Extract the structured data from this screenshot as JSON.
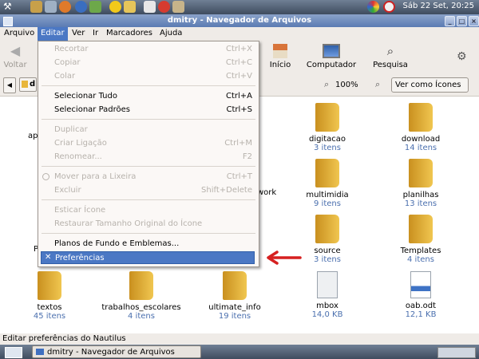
{
  "window": {
    "title": "dmitry - Navegador de Arquivos"
  },
  "top_panel": {
    "clock": "Sáb 22 Set, 20:25"
  },
  "menubar": [
    "Arquivo",
    "Editar",
    "Ver",
    "Ir",
    "Marcadores",
    "Ajuda"
  ],
  "toolbar": {
    "back": "Voltar",
    "home": "Início",
    "computer": "Computador",
    "search": "Pesquisa"
  },
  "location": {
    "zoom": "100%",
    "view_mode": "Ver como Ícones"
  },
  "edit_menu": {
    "cut": "Recortar",
    "cut_accel": "Ctrl+X",
    "copy": "Copiar",
    "copy_accel": "Ctrl+C",
    "paste": "Colar",
    "paste_accel": "Ctrl+V",
    "select_all": "Selecionar Tudo",
    "select_all_accel": "Ctrl+A",
    "select_pattern": "Selecionar Padrões",
    "select_pattern_accel": "Ctrl+S",
    "duplicate": "Duplicar",
    "make_link": "Criar Ligação",
    "make_link_accel": "Ctrl+M",
    "rename": "Renomear...",
    "rename_accel": "F2",
    "trash": "Mover para a Lixeira",
    "trash_accel": "Ctrl+T",
    "delete": "Excluir",
    "delete_accel": "Shift+Delete",
    "stretch": "Esticar Ícone",
    "restore_size": "Restaurar Tamanho Original do Ícone",
    "backgrounds": "Planos de Fundo e Emblemas...",
    "preferences": "Preferências"
  },
  "files": [
    {
      "name": "digitacao",
      "info": "3 itens"
    },
    {
      "name": "download",
      "info": "14 itens"
    },
    {
      "name": "multimidia",
      "info": "9 itens"
    },
    {
      "name": "planilhas",
      "info": "13 itens"
    },
    {
      "name": "source",
      "info": "3 itens"
    },
    {
      "name": "Templates",
      "info": "4 itens"
    },
    {
      "name": "textos",
      "info": "45 itens"
    },
    {
      "name": "trabalhos_escolares",
      "info": "4 itens"
    },
    {
      "name": "ultimate_info",
      "info": "19 itens"
    },
    {
      "name": "mbox",
      "info": "14,0 KB"
    },
    {
      "name": "oab.odt",
      "info": "12,1 KB"
    }
  ],
  "partial_labels": {
    "left_top": "ap",
    "left_mid": "P",
    "network_tail": "work",
    "loc_path": "d"
  },
  "status": "Editar preferências do Nautilus",
  "taskbar": {
    "window": "dmitry - Navegador de Arquivos"
  },
  "colors": {
    "highlight": "#4b78c4",
    "folder": "#e8b63a",
    "arrow": "#d62020",
    "size_text": "#4a6fae"
  }
}
